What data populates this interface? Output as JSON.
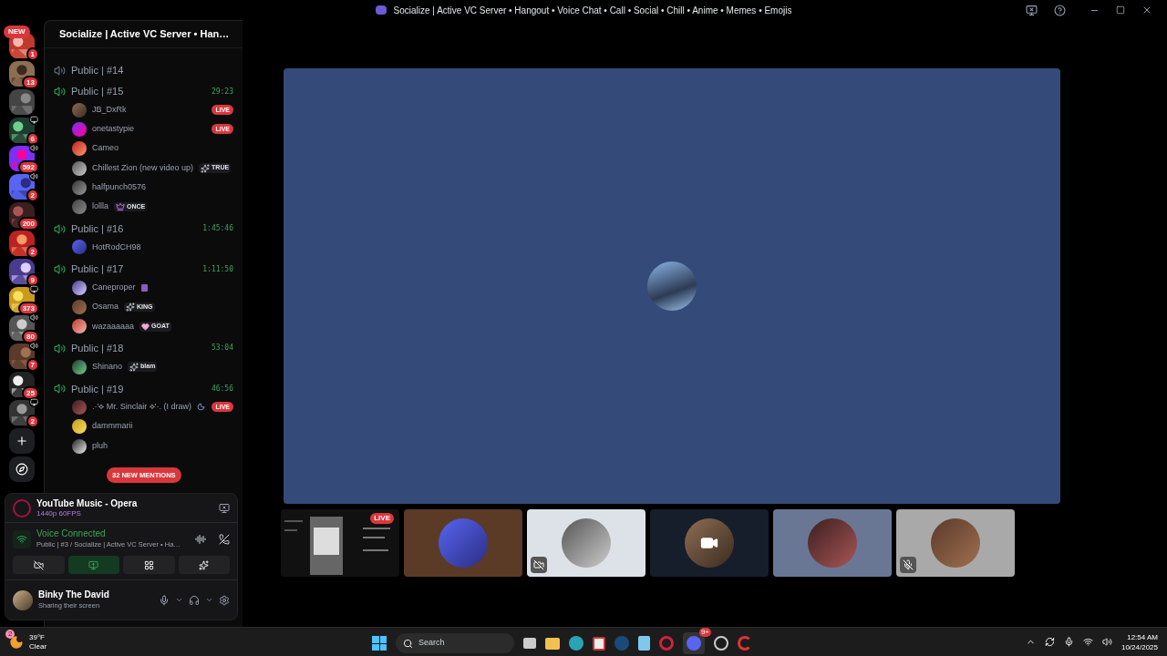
{
  "window": {
    "title": "Socialize | Active VC Server • Hangout • Voice Chat • Call • Social • Chill • Anime • Memes • Emojis"
  },
  "servers": [
    {
      "badge": "1",
      "pill": "NEW"
    },
    {
      "badge": "13"
    },
    {
      "screen": false
    },
    {
      "badge": "6",
      "screen": true
    },
    {
      "badge": "592",
      "voice": true
    },
    {
      "badge": "2",
      "voice": true
    },
    {
      "badge": "200"
    },
    {
      "badge": "2"
    },
    {
      "badge": "9"
    },
    {
      "badge": "373",
      "screen": true
    },
    {
      "badge": "80",
      "voice": true
    },
    {
      "badge": "7",
      "voice": true
    },
    {
      "badge": "25"
    },
    {
      "badge": "2",
      "screen": true
    }
  ],
  "sidebar": {
    "title": "Socialize | Active VC Server • Han…",
    "channels": [
      {
        "name": "Public | #14",
        "active": false
      },
      {
        "name": "Public | #15",
        "active": true,
        "timer": "29:23",
        "users": [
          {
            "name": "JB_DxRk",
            "live": "LIVE"
          },
          {
            "name": "onetastypie",
            "live": "LIVE"
          },
          {
            "name": "Cameo"
          },
          {
            "name": "Chillest Zion (new video up)",
            "tag": "TRUE"
          },
          {
            "name": "halfpunch0576"
          },
          {
            "name": "lollla",
            "tag": "ONCE"
          }
        ]
      },
      {
        "name": "Public | #16",
        "active": true,
        "timer": "1:45:46",
        "users": [
          {
            "name": "HotRodCH98"
          }
        ]
      },
      {
        "name": "Public | #17",
        "active": true,
        "timer": "1:11:50",
        "users": [
          {
            "name": "Caneproper",
            "badge_icon": true
          },
          {
            "name": "Osama",
            "tag": "KING"
          },
          {
            "name": "wazaaaaaa",
            "tag": "GOAT"
          }
        ]
      },
      {
        "name": "Public | #18",
        "active": true,
        "timer": "53:04",
        "users": [
          {
            "name": "Shinano",
            "tag": "blam"
          }
        ]
      },
      {
        "name": "Public | #19",
        "active": true,
        "timer": "46:56",
        "users": [
          {
            "name": ".·'⟡ Mr. Sinclair ⟡'·. (I draw)",
            "badge_icon": true,
            "live": "LIVE"
          },
          {
            "name": "dammmarii"
          },
          {
            "name": "pluh"
          }
        ]
      }
    ],
    "mentions": "32 NEW MENTIONS"
  },
  "stream": {
    "title": "YouTube Music - Opera",
    "quality": "1440p 60FPS"
  },
  "voice": {
    "status": "Voice Connected",
    "channel": "Public | #3 / Socialize | Active VC Server • Ha…",
    "actions": [
      {
        "kind": "camera",
        "selected": false
      },
      {
        "kind": "screen",
        "selected": true
      },
      {
        "kind": "activities",
        "selected": false
      },
      {
        "kind": "soundboard",
        "selected": false
      }
    ]
  },
  "user": {
    "name": "Binky The David",
    "status": "Sharing their screen"
  },
  "tiles": [
    {
      "kind": "stream",
      "live": "LIVE",
      "color": "#111111"
    },
    {
      "kind": "user",
      "color": "#5b3a26"
    },
    {
      "kind": "user",
      "color": "#dde1e8",
      "video_off": true
    },
    {
      "kind": "user",
      "color": "#161d2b",
      "camera": true
    },
    {
      "kind": "user",
      "color": "#6a7794"
    },
    {
      "kind": "user",
      "color": "#a9a9a9",
      "muted": true
    }
  ],
  "taskbar": {
    "temperature": "39°F",
    "weather": "Clear",
    "weather_badge": "2",
    "search_placeholder": "Search",
    "discord_badge": "9+",
    "time": "12:54 AM",
    "date": "10/24/2025"
  }
}
